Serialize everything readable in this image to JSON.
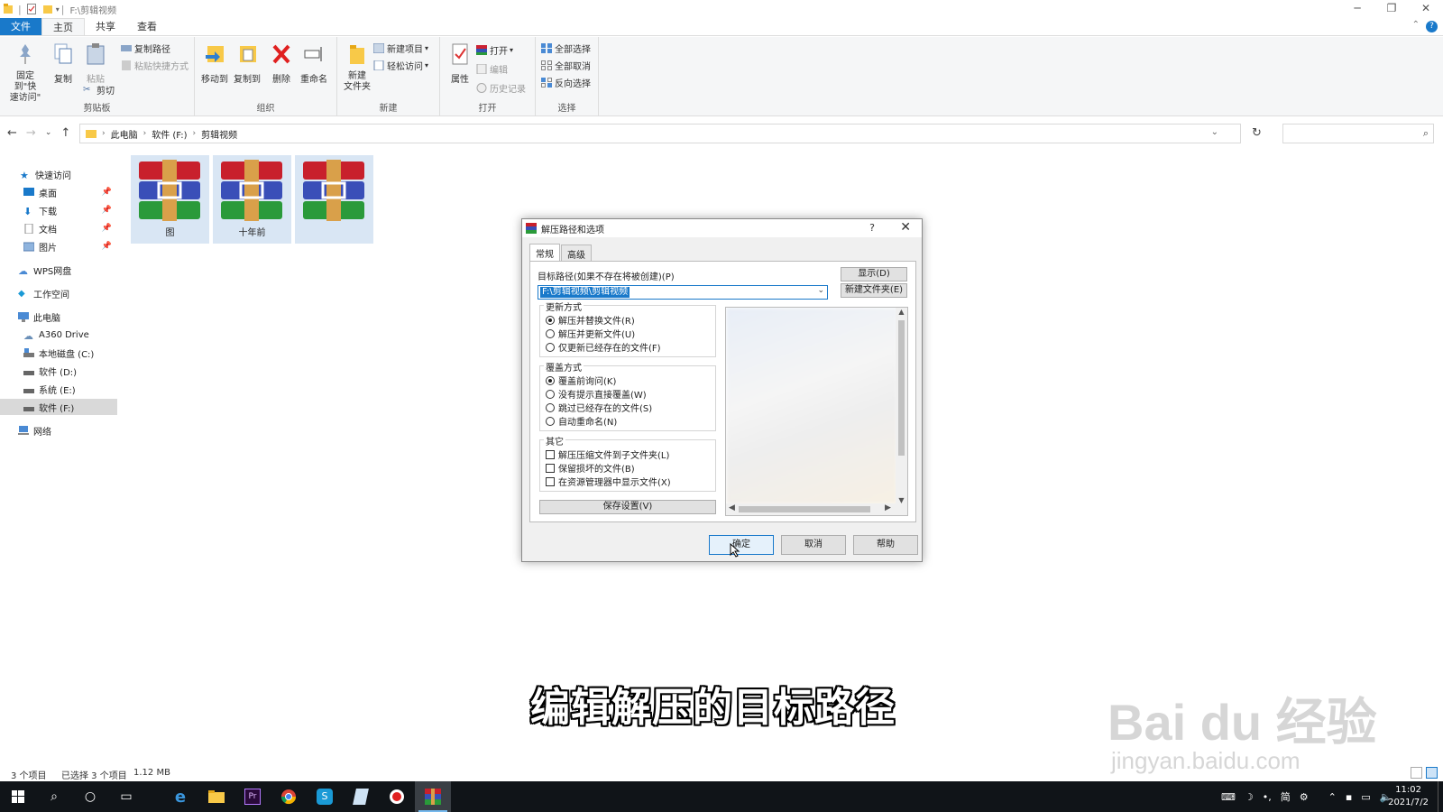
{
  "window": {
    "path": "F:\\剪辑视频",
    "controls": [
      "─",
      "❐",
      "✕"
    ]
  },
  "ribbon_tabs": [
    "文件",
    "主页",
    "共享",
    "查看"
  ],
  "ribbon": {
    "clipboard": {
      "pin_quick": "固定到\"快\n速访问\"",
      "copy": "复制",
      "paste": "粘贴",
      "copy_path": "复制路径",
      "paste_shortcut": "粘贴快捷方式",
      "cut": "剪切",
      "label": "剪贴板"
    },
    "organize": {
      "move_to": "移动到",
      "copy_to": "复制到",
      "delete": "删除",
      "rename": "重命名",
      "label": "组织"
    },
    "new": {
      "new_folder": "新建\n文件夹",
      "new_item": "新建项目",
      "easy_access": "轻松访问",
      "label": "新建"
    },
    "open": {
      "properties": "属性",
      "open": "打开",
      "edit": "编辑",
      "history": "历史记录",
      "label": "打开"
    },
    "select": {
      "select_all": "全部选择",
      "select_none": "全部取消",
      "invert": "反向选择",
      "label": "选择"
    }
  },
  "address": {
    "crumbs": [
      "此电脑",
      "软件 (F:)",
      "剪辑视频"
    ]
  },
  "nav": {
    "quick_access": "快速访问",
    "desktop": "桌面",
    "downloads": "下载",
    "documents": "文档",
    "pictures": "图片",
    "wps": "WPS网盘",
    "workspace": "工作空间",
    "this_pc": "此电脑",
    "a360": "A360 Drive",
    "c": "本地磁盘 (C:)",
    "d": "软件 (D:)",
    "e": "系统 (E:)",
    "f": "软件 (F:)",
    "network": "网络"
  },
  "files": [
    {
      "name": "图"
    },
    {
      "name": "十年前"
    },
    {
      "name": ""
    }
  ],
  "dialog": {
    "title": "解压路径和选项",
    "help_btn": "?",
    "close_btn": "✕",
    "tabs": [
      "常规",
      "高级"
    ],
    "target_label": "目标路径(如果不存在将被创建)(P)",
    "target_value": "F:\\剪辑视频\\剪辑视频",
    "show_btn": "显示(D)",
    "new_folder_btn": "新建文件夹(E)",
    "update_mode": {
      "title": "更新方式",
      "options": [
        "解压并替换文件(R)",
        "解压并更新文件(U)",
        "仅更新已经存在的文件(F)"
      ]
    },
    "overwrite_mode": {
      "title": "覆盖方式",
      "options": [
        "覆盖前询问(K)",
        "没有提示直接覆盖(W)",
        "跳过已经存在的文件(S)",
        "自动重命名(N)"
      ]
    },
    "other": {
      "title": "其它",
      "options": [
        "解压压缩文件到子文件夹(L)",
        "保留损坏的文件(B)",
        "在资源管理器中显示文件(X)"
      ]
    },
    "save_btn": "保存设置(V)",
    "ok_btn": "确定",
    "cancel_btn": "取消",
    "help_btn2": "帮助"
  },
  "subtitle": "编辑解压的目标路径",
  "watermark": {
    "brand": "Bai du 经验",
    "url": "jingyan.baidu.com"
  },
  "status": {
    "count": "3 个项目",
    "selected": "已选择 3 个项目",
    "size": "1.12 MB"
  },
  "tray": {
    "ime": "简",
    "time": "11:02",
    "date": "2021/7/2"
  },
  "colors": {
    "accent": "#1979ca",
    "taskbar": "#101418",
    "tile_selected": "#d9e6f4"
  }
}
